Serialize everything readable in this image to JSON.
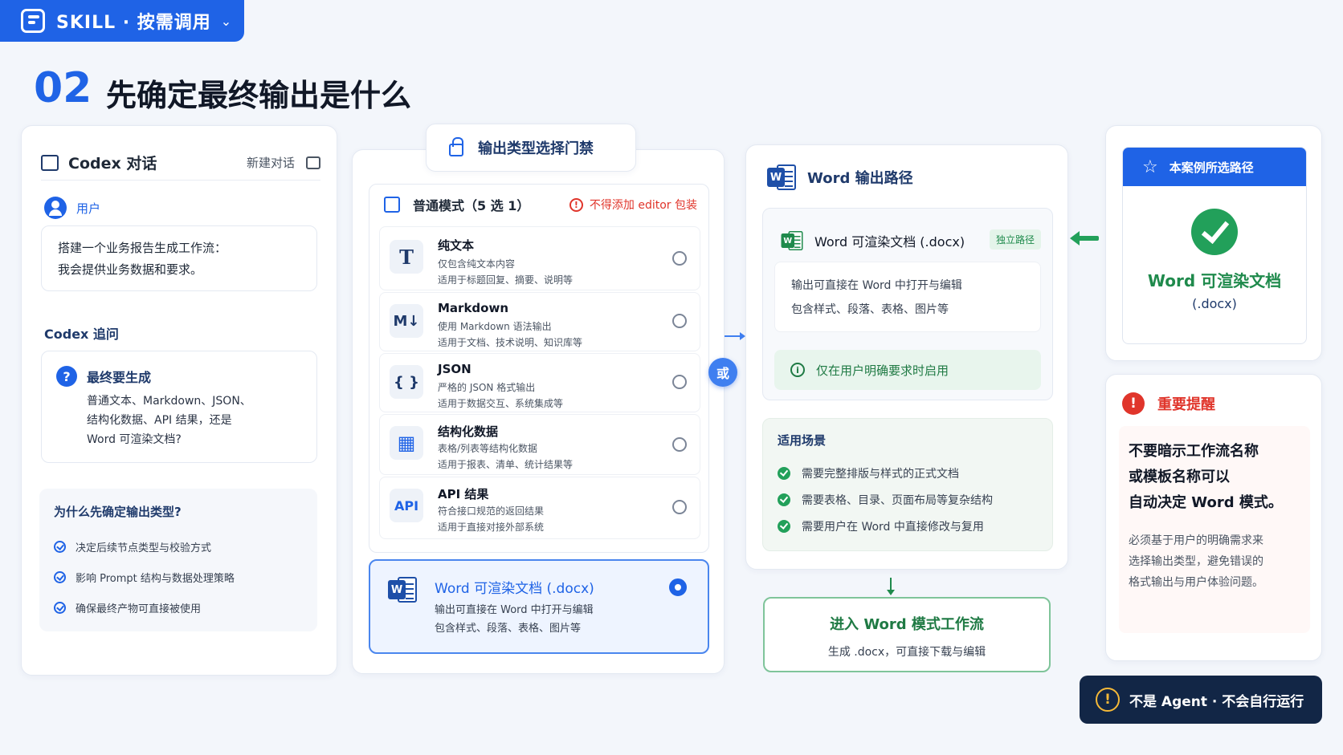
{
  "badge": {
    "text": "SKILL · 按需调用",
    "chevron": "⌄"
  },
  "title": {
    "num": "02",
    "text": "先确定最终输出是什么"
  },
  "codex": {
    "title": "Codex 对话",
    "new_chat": "新建对话",
    "user_label": "用户",
    "user_msg_1": "搭建一个业务报告生成工作流：",
    "user_msg_2": "我会提供业务数据和要求。",
    "followup_label": "Codex 追问",
    "question_icon": "?",
    "question_title": "最终要生成",
    "question_body_1": "普通文本、Markdown、JSON、",
    "question_body_2": "结构化数据、API 结果，还是",
    "question_body_3": "Word 可渲染文档?",
    "why_title": "为什么先确定输出类型?",
    "why_items": [
      "决定后续节点类型与校验方式",
      "影响 Prompt 结构与数据处理策略",
      "确保最终产物可直接被使用"
    ]
  },
  "gate": {
    "title": "输出类型选择门禁"
  },
  "normal": {
    "title": "普通模式（5 选 1）",
    "warn_icon": "!",
    "warning": "不得添加 editor 包装",
    "options": [
      {
        "icon": "T",
        "title": "纯文本",
        "desc1": "仅包含纯文本内容",
        "desc2": "适用于标题回复、摘要、说明等"
      },
      {
        "icon": "M↓",
        "title": "Markdown",
        "desc1": "使用 Markdown 语法输出",
        "desc2": "适用于文档、技术说明、知识库等"
      },
      {
        "icon": "{ }",
        "title": "JSON",
        "desc1": "严格的 JSON 格式输出",
        "desc2": "适用于数据交互、系统集成等"
      },
      {
        "icon": "▦",
        "title": "结构化数据",
        "desc1": "表格/列表等结构化数据",
        "desc2": "适用于报表、清单、统计结果等"
      },
      {
        "icon": "API",
        "title": "API 结果",
        "desc1": "符合接口规范的返回结果",
        "desc2": "适用于直接对接外部系统"
      }
    ],
    "selected": {
      "title": "Word 可渲染文档 (.docx)",
      "desc1": "输出可直接在 Word 中打开与编辑",
      "desc2": "包含样式、段落、表格、图片等"
    },
    "or_label": "或"
  },
  "word_path": {
    "title": "Word 输出路径",
    "docx_title": "Word 可渲染文档 (.docx)",
    "tag": "独立路径",
    "desc1": "输出可直接在 Word 中打开与编辑",
    "desc2": "包含样式、段落、表格、图片等",
    "info_icon": "i",
    "only_when": "仅在用户明确要求时启用",
    "scenes_title": "适用场景",
    "scenes": [
      "需要完整排版与样式的正式文档",
      "需要表格、目录、页面布局等复杂结构",
      "需要用户在 Word 中直接修改与复用"
    ]
  },
  "enter": {
    "title": "进入 Word 模式工作流",
    "sub": "生成 .docx，可直接下载与编辑"
  },
  "picked": {
    "header": "本案例所选路径",
    "star": "☆",
    "title": "Word 可渲染文档",
    "sub": "(.docx)"
  },
  "reminder": {
    "icon": "!",
    "title": "重要提醒",
    "big1": "不要暗示工作流名称",
    "big2": "或模板名称可以",
    "big3": "自动决定 Word 模式。",
    "small1": "必须基于用户的明确需求来",
    "small2": "选择输出类型，避免错误的",
    "small3": "格式输出与用户体验问题。"
  },
  "footer": {
    "icon": "!",
    "text": "不是 Agent · 不会自行运行"
  },
  "word_letter": "W"
}
